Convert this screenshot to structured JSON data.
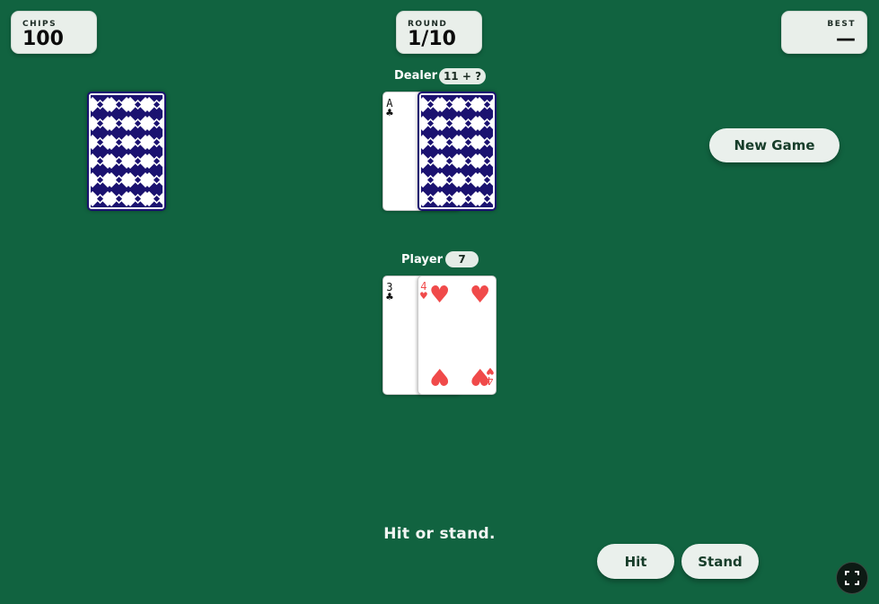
{
  "theme": {
    "felt": "#116340",
    "card_back": "#1b1270",
    "suit_red": "#f04a4a",
    "suit_black": "#111111"
  },
  "hud": {
    "chips": {
      "label": "CHIPS",
      "value": "100"
    },
    "round": {
      "label": "ROUND",
      "value": "1/10"
    },
    "best": {
      "label": "BEST",
      "value": "—"
    }
  },
  "deck": {
    "face": "down"
  },
  "dealer": {
    "label": "Dealer",
    "total": "11 + ?",
    "cards": [
      {
        "rank": "A",
        "suit": "♣",
        "color": "black",
        "face": "up"
      },
      {
        "face": "down"
      }
    ]
  },
  "player": {
    "label": "Player",
    "total": "7",
    "cards": [
      {
        "rank": "3",
        "suit": "♣",
        "color": "black",
        "face": "up"
      },
      {
        "rank": "4",
        "suit": "♥",
        "color": "red",
        "face": "up"
      }
    ]
  },
  "buttons": {
    "new_game": "New Game",
    "hit": "Hit",
    "stand": "Stand"
  },
  "status": "Hit or stand.",
  "icons": {
    "fullscreen": "fullscreen-icon"
  }
}
